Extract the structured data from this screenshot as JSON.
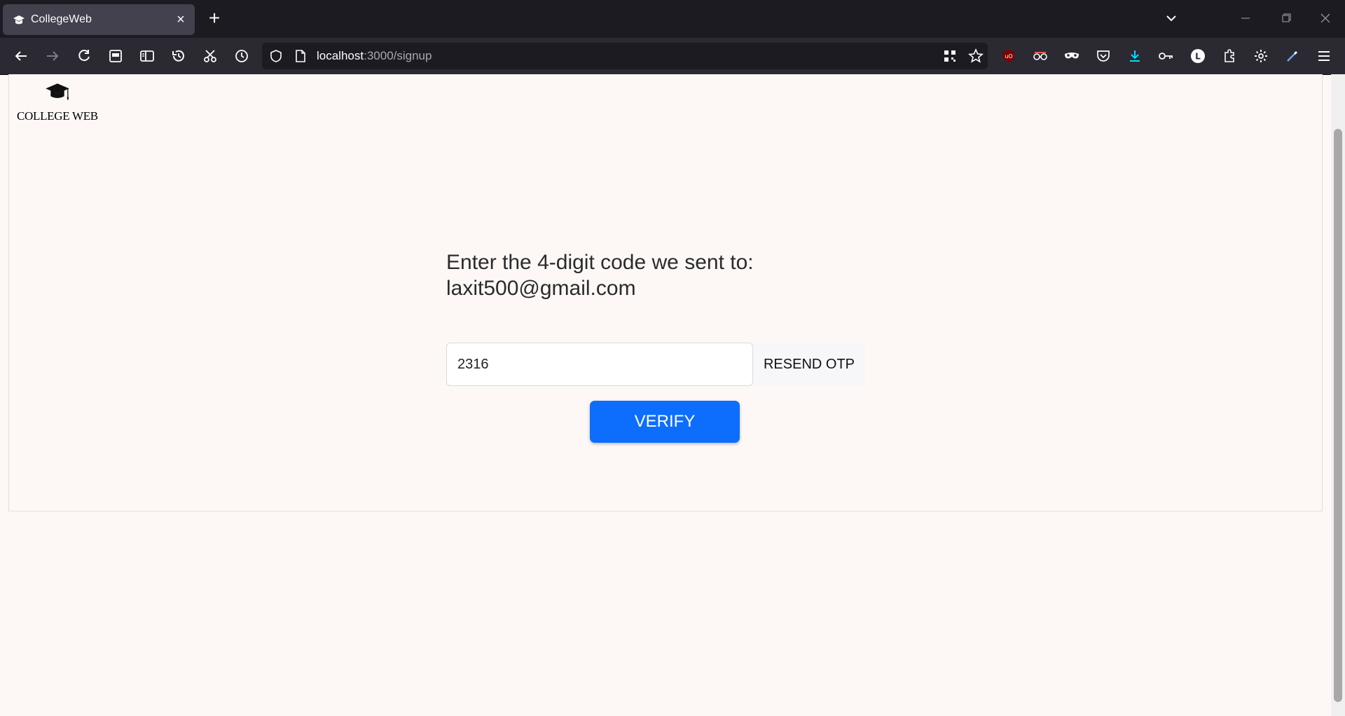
{
  "browser": {
    "tab_title": "CollegeWeb",
    "url_host": "localhost",
    "url_path": ":3000/signup",
    "extension_profile_letter": "L",
    "ublock_badge": "uO",
    "accent_colors": {
      "download": "#00ddff",
      "ublock": "#800000"
    }
  },
  "page": {
    "logo_text": "COLLEGE WEB",
    "prompt_line1": "Enter the 4-digit code we sent to:",
    "prompt_line2": "laxit500@gmail.com",
    "otp_value": "2316",
    "resend_label": "RESEND OTP",
    "verify_label": "VERIFY",
    "primary_color": "#0d6efd"
  }
}
